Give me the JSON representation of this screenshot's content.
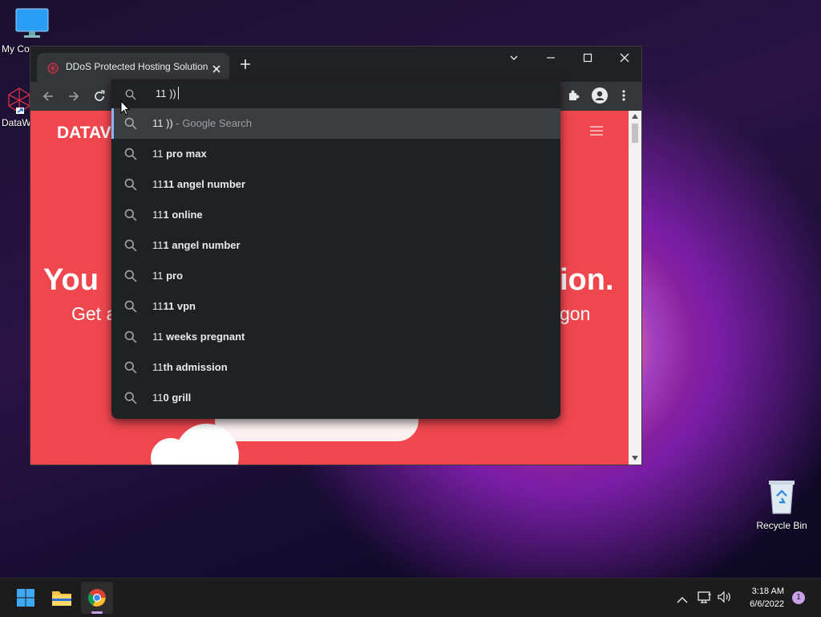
{
  "desktop": {
    "icons": [
      {
        "label": "My Co",
        "name": "my-computer"
      },
      {
        "label": "DataW",
        "name": "dataw"
      },
      {
        "label": "Recycle Bin",
        "name": "recycle-bin"
      }
    ]
  },
  "browser": {
    "tab_title": "DDoS Protected Hosting Solution",
    "new_tab": "+",
    "omnibox": {
      "value": "11 ))",
      "suggestions": [
        {
          "prefix": "11 ))",
          "rest": "",
          "suffix": " - Google Search"
        },
        {
          "prefix": "11",
          "rest": " pro max",
          "suffix": ""
        },
        {
          "prefix": "11",
          "rest": "11 angel number",
          "suffix": ""
        },
        {
          "prefix": "11",
          "rest": "1 online",
          "suffix": ""
        },
        {
          "prefix": "11",
          "rest": "1 angel number",
          "suffix": ""
        },
        {
          "prefix": "11",
          "rest": " pro",
          "suffix": ""
        },
        {
          "prefix": "11",
          "rest": "11 vpn",
          "suffix": ""
        },
        {
          "prefix": "11",
          "rest": " weeks pregnant",
          "suffix": ""
        },
        {
          "prefix": "11",
          "rest": "th admission",
          "suffix": ""
        },
        {
          "prefix": "11",
          "rest": "0 grill",
          "suffix": ""
        }
      ]
    },
    "page": {
      "brand": "DATAV",
      "headline_left": "You",
      "headline_right": "ion.",
      "sub_left": "Get a",
      "sub_right": "gon",
      "accent": "#f0474f"
    }
  },
  "taskbar": {
    "time": "3:18 AM",
    "date": "6/6/2022",
    "notification_count": "1"
  }
}
